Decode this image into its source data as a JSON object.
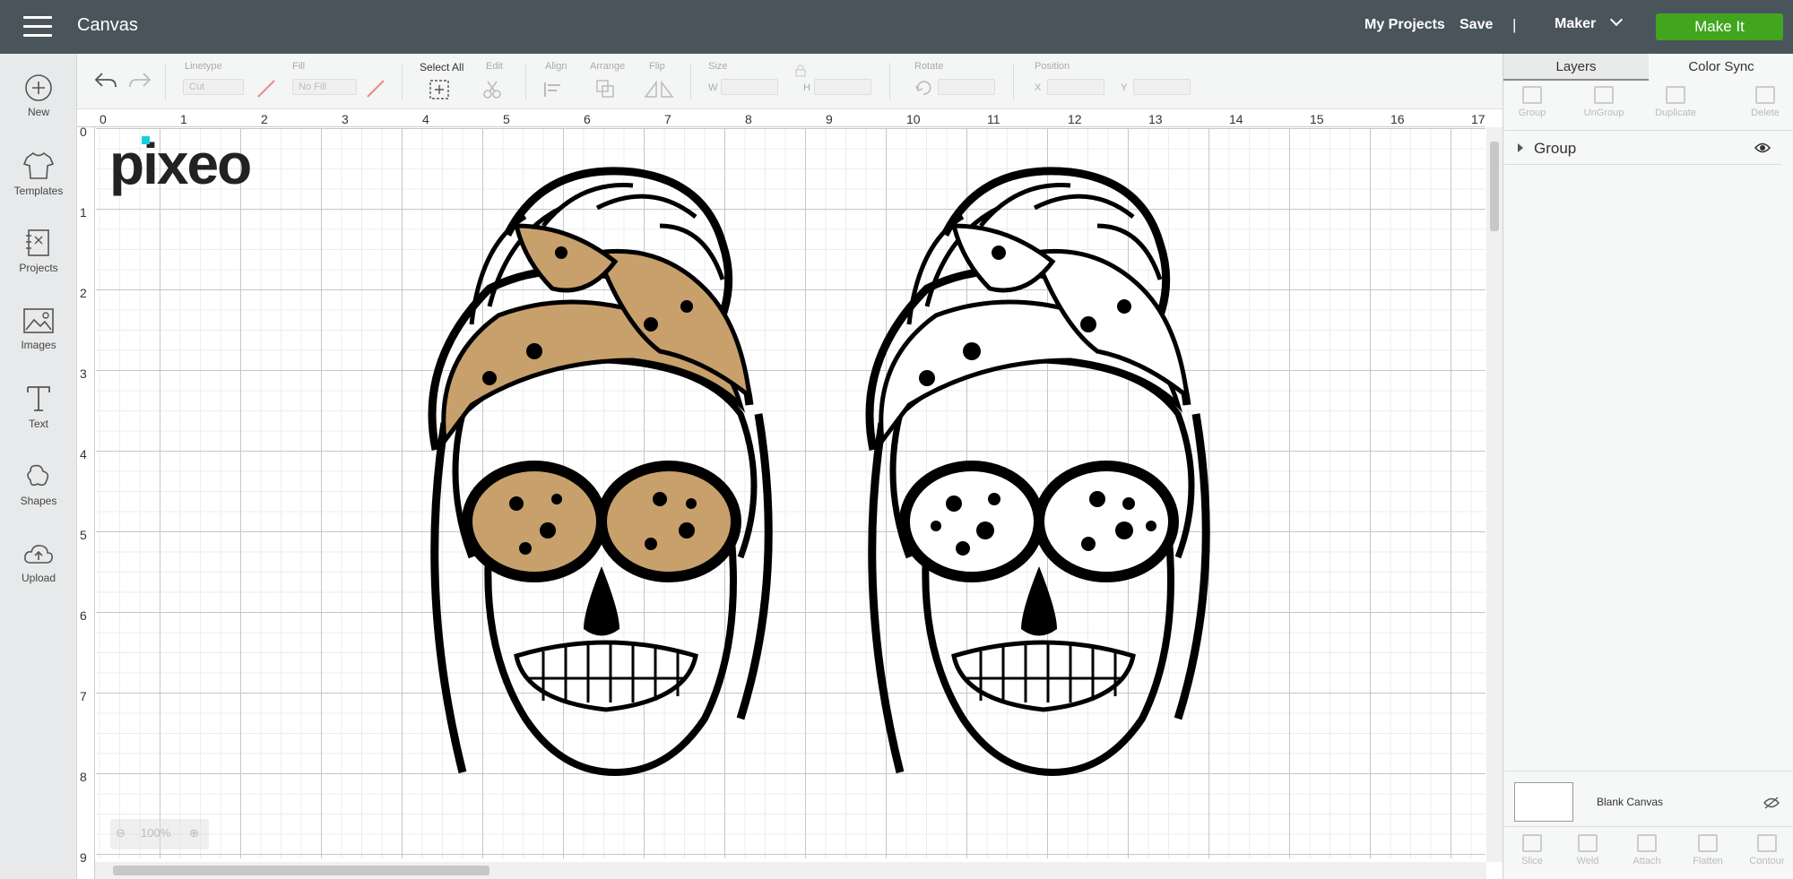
{
  "topbar": {
    "title": "Canvas",
    "my_projects": "My Projects",
    "save": "Save",
    "separator": "|",
    "machine": "Maker",
    "make_it": "Make It",
    "accent_color": "#41a51d"
  },
  "sidebar": {
    "items": [
      {
        "label": "New",
        "icon": "plus-circle-icon"
      },
      {
        "label": "Templates",
        "icon": "tshirt-icon"
      },
      {
        "label": "Projects",
        "icon": "notebook-icon"
      },
      {
        "label": "Images",
        "icon": "image-icon"
      },
      {
        "label": "Text",
        "icon": "text-t-icon"
      },
      {
        "label": "Shapes",
        "icon": "shapes-icon"
      },
      {
        "label": "Upload",
        "icon": "cloud-upload-icon"
      }
    ]
  },
  "toolbar": {
    "linetype_label": "Linetype",
    "linetype_value": "Cut",
    "fill_label": "Fill",
    "fill_value": "No Fill",
    "select_all": "Select All",
    "edit": "Edit",
    "align": "Align",
    "arrange": "Arrange",
    "flip": "Flip",
    "size": "Size",
    "size_w": "W",
    "size_h": "H",
    "rotate": "Rotate",
    "position": "Position",
    "pos_x": "X",
    "pos_y": "Y"
  },
  "canvas": {
    "ruler_x": [
      "0",
      "1",
      "2",
      "3",
      "4",
      "5",
      "6",
      "7",
      "8",
      "9",
      "10",
      "11",
      "12",
      "13",
      "14",
      "15",
      "16",
      "17"
    ],
    "ruler_y": [
      "0",
      "1",
      "2",
      "3",
      "4",
      "5",
      "6",
      "7",
      "8",
      "9"
    ],
    "zoom": "100%",
    "watermark": "pixeo"
  },
  "panel": {
    "tab_layers": "Layers",
    "tab_color_sync": "Color Sync",
    "actions_top": [
      "Group",
      "UnGroup",
      "Duplicate",
      "Delete"
    ],
    "layer_name": "Group",
    "blank_canvas": "Blank Canvas",
    "actions_bottom": [
      "Slice",
      "Weld",
      "Attach",
      "Flatten",
      "Contour"
    ]
  }
}
